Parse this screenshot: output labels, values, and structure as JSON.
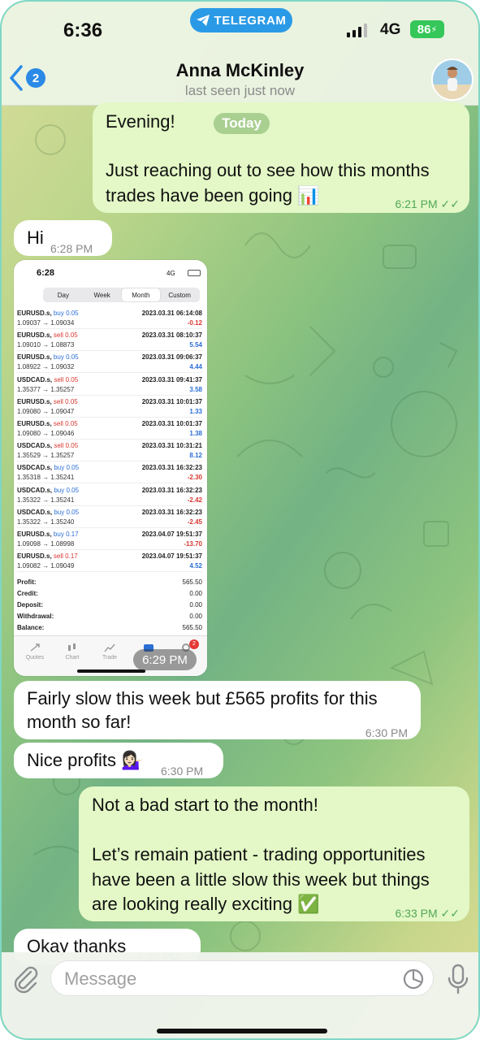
{
  "status_bar": {
    "time": "6:36",
    "app_pill": "TELEGRAM",
    "network": "4G",
    "battery": "86"
  },
  "header": {
    "back_count": "2",
    "contact_name": "Anna McKinley",
    "contact_status": "last seen just now"
  },
  "date_pill": "Today",
  "messages": [
    {
      "direction": "out",
      "text_line1": "Evening!",
      "text_line2": "Just reaching out to see how this months",
      "text_line3": "trades have been going 📊",
      "time": "6:21 PM"
    },
    {
      "direction": "in",
      "text": "Hi",
      "time": "6:28 PM"
    },
    {
      "direction": "in",
      "type": "photo",
      "time": "6:29 PM"
    },
    {
      "direction": "in",
      "text_line1": "Fairly slow this week but £565 profits for this",
      "text_line2": "month so far!",
      "time": "6:30 PM"
    },
    {
      "direction": "in",
      "text": "Nice profits 💁🏻‍♀️",
      "time": "6:30 PM"
    },
    {
      "direction": "out",
      "text_line1": "Not a bad start to the month!",
      "text_line2": "Let’s remain patient - trading opportunities",
      "text_line3": "have been a little slow this week but things",
      "text_line4": "are looking really exciting ✅",
      "time": "6:33 PM"
    },
    {
      "direction": "in",
      "text": "Okay thanks",
      "time": "6:35 PM"
    }
  ],
  "photo": {
    "time": "6:28",
    "network": "4G",
    "segments": [
      "Day",
      "Week",
      "Month",
      "Custom"
    ],
    "selected_segment": "Month",
    "deals": [
      {
        "symbol": "EURUSD.s,",
        "dir": "buy",
        "lots": "0.05",
        "prices": "1.09037 → 1.09034",
        "date": "2023.03.31 06:14:08",
        "pl": "-0.12"
      },
      {
        "symbol": "EURUSD.s,",
        "dir": "sell",
        "lots": "0.05",
        "prices": "1.09010 → 1.08873",
        "date": "2023.03.31 08:10:37",
        "pl": "5.54"
      },
      {
        "symbol": "EURUSD.s,",
        "dir": "buy",
        "lots": "0.05",
        "prices": "1.08922 → 1.09032",
        "date": "2023.03.31 09:06:37",
        "pl": "4.44"
      },
      {
        "symbol": "USDCAD.s,",
        "dir": "sell",
        "lots": "0.05",
        "prices": "1.35377 → 1.35257",
        "date": "2023.03.31 09:41:37",
        "pl": "3.58"
      },
      {
        "symbol": "EURUSD.s,",
        "dir": "sell",
        "lots": "0.05",
        "prices": "1.09080 → 1.09047",
        "date": "2023.03.31 10:01:37",
        "pl": "1.33"
      },
      {
        "symbol": "EURUSD.s,",
        "dir": "sell",
        "lots": "0.05",
        "prices": "1.09080 → 1.09046",
        "date": "2023.03.31 10:01:37",
        "pl": "1.38"
      },
      {
        "symbol": "USDCAD.s,",
        "dir": "sell",
        "lots": "0.05",
        "prices": "1.35529 → 1.35257",
        "date": "2023.03.31 10:31:21",
        "pl": "8.12"
      },
      {
        "symbol": "USDCAD.s,",
        "dir": "buy",
        "lots": "0.05",
        "prices": "1.35318 → 1.35241",
        "date": "2023.03.31 16:32:23",
        "pl": "-2.30"
      },
      {
        "symbol": "USDCAD.s,",
        "dir": "buy",
        "lots": "0.05",
        "prices": "1.35322 → 1.35241",
        "date": "2023.03.31 16:32:23",
        "pl": "-2.42"
      },
      {
        "symbol": "USDCAD.s,",
        "dir": "buy",
        "lots": "0.05",
        "prices": "1.35322 → 1.35240",
        "date": "2023.03.31 16:32:23",
        "pl": "-2.45"
      },
      {
        "symbol": "EURUSD.s,",
        "dir": "buy",
        "lots": "0.17",
        "prices": "1.09098 → 1.08998",
        "date": "2023.04.07 19:51:37",
        "pl": "-13.70"
      },
      {
        "symbol": "EURUSD.s,",
        "dir": "sell",
        "lots": "0.17",
        "prices": "1.09082 → 1.09049",
        "date": "2023.04.07 19:51:37",
        "pl": "4.52"
      }
    ],
    "summary": [
      {
        "label": "Profit:",
        "value": "565.50"
      },
      {
        "label": "Credit:",
        "value": "0.00"
      },
      {
        "label": "Deposit:",
        "value": "0.00"
      },
      {
        "label": "Withdrawal:",
        "value": "0.00"
      },
      {
        "label": "Balance:",
        "value": "565.50"
      }
    ],
    "tabs": [
      "Quotes",
      "Chart",
      "Trade"
    ],
    "tab_badge": "2"
  },
  "input": {
    "placeholder": "Message"
  },
  "colors": {
    "accent": "#2a8ae6",
    "outgoing_bubble": "#e3f8c6",
    "incoming_bubble": "#ffffff",
    "buy": "#2a6ed6",
    "sell": "#d8362f"
  }
}
